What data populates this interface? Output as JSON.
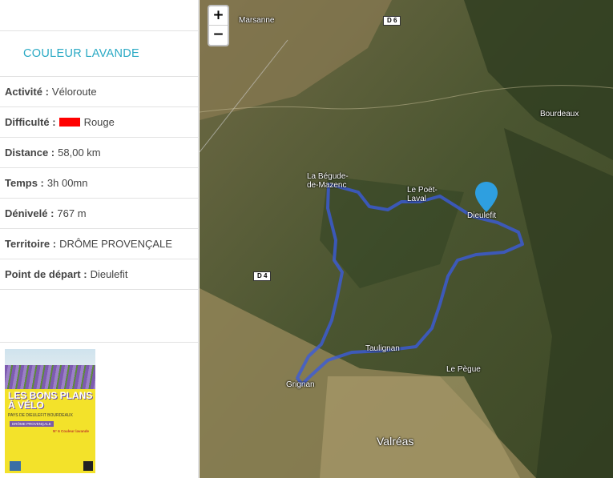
{
  "sidebar": {
    "title": "COULEUR LAVANDE",
    "rows": [
      {
        "label": "Activité :",
        "value": "Véloroute"
      },
      {
        "label": "Difficulté :",
        "value": "Rouge",
        "color": "#ff0000"
      },
      {
        "label": "Distance :",
        "value": "58,00 km"
      },
      {
        "label": "Temps :",
        "value": "3h 00mn"
      },
      {
        "label": "Dénivelé :",
        "value": "767 m"
      },
      {
        "label": "Territoire :",
        "value": "DRÔME PROVENÇALE"
      },
      {
        "label": "Point de départ :",
        "value": "Dieulefit"
      }
    ],
    "cover": {
      "headline": "LES BONS PLANS À VÉLO",
      "subtitle": "PAYS DE DIEULEFIT BOURDEAUX",
      "region": "DRÔME PROVENÇALE",
      "route": "N° 6 Couleur lavande"
    }
  },
  "map": {
    "zoom_in": "+",
    "zoom_out": "−",
    "places": {
      "marsanne": "Marsanne",
      "bourdeaux": "Bourdeaux",
      "begude": "La Bégude-de-Mazenc",
      "poet": "Le Poët-Laval",
      "dieulefit": "Dieulefit",
      "taulignan": "Taulignan",
      "pegue": "Le Pègue",
      "grignan": "Grignan",
      "valreas": "Valréas"
    },
    "roads": {
      "d6": "D 6",
      "d4": "D 4"
    },
    "route_color": "#3b5bdb",
    "marker_color": "#2e9fe0",
    "marker_icon": "map-pin-icon"
  }
}
